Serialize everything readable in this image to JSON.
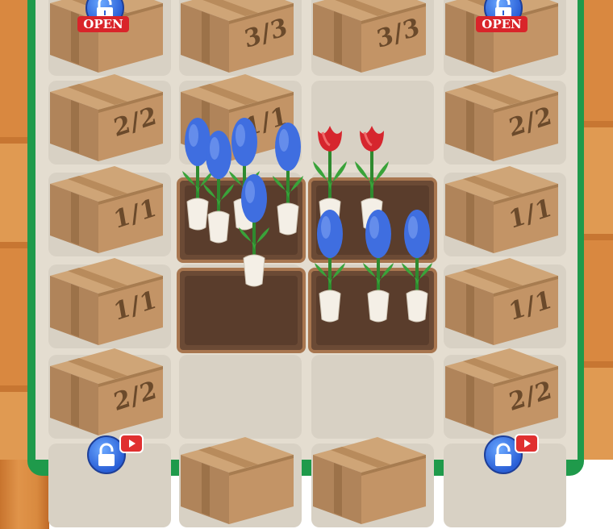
{
  "locks": {
    "open_label": "OPEN"
  },
  "boxes": [
    {
      "id": "r1c2",
      "label": "3/3"
    },
    {
      "id": "r1c3",
      "label": "3/3"
    },
    {
      "id": "r2c1",
      "label": "2/2"
    },
    {
      "id": "r2c2",
      "label": "1/1"
    },
    {
      "id": "r2c4",
      "label": "2/2"
    },
    {
      "id": "r3c1",
      "label": "1/1"
    },
    {
      "id": "r3c4",
      "label": "1/1"
    },
    {
      "id": "r4c1",
      "label": "1/1"
    },
    {
      "id": "r4c4",
      "label": "1/1"
    },
    {
      "id": "r5c1",
      "label": "2/2"
    },
    {
      "id": "r5c4",
      "label": "2/2"
    }
  ],
  "colors": {
    "board_border": "#1f9a4b",
    "hyacinth": "#3f6ee0",
    "tulip": "#d6262e",
    "lock_blue": "#2a5fd6",
    "open_red": "#d9242a"
  },
  "icons": [
    "lock-icon",
    "video-ad-icon",
    "hyacinth-flower",
    "tulip-flower",
    "cardboard-box"
  ]
}
